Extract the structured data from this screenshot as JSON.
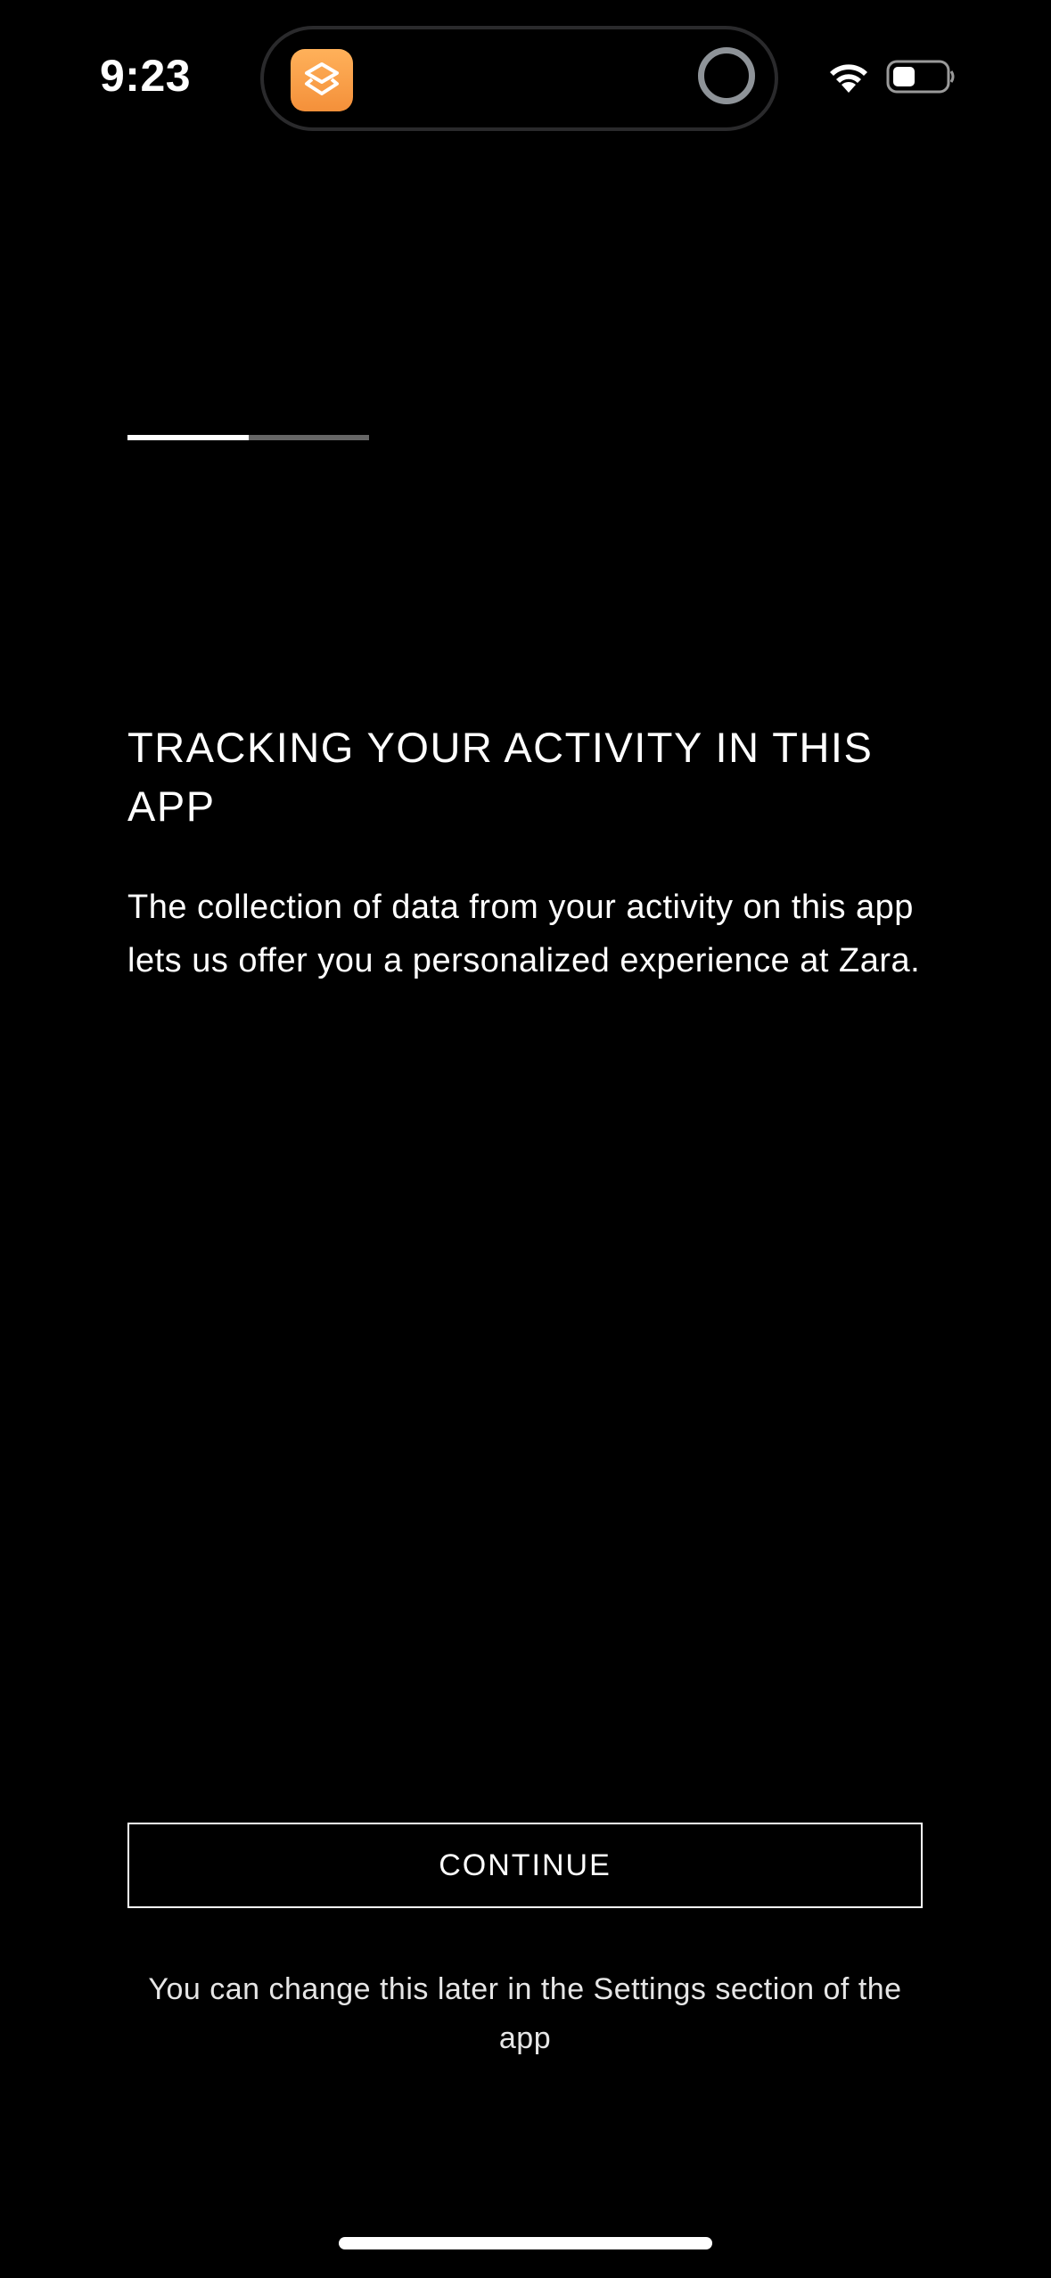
{
  "status_bar": {
    "time": "9:23",
    "live_activity_icon": "shortcuts-app-icon",
    "wifi_icon": "wifi-icon",
    "battery_icon": "battery-icon"
  },
  "onboarding": {
    "progress": {
      "fraction": 0.5
    },
    "title": "TRACKING YOUR ACTIVITY IN THIS APP",
    "description": "The collection of data from your activity on this app lets us offer you a personalized experience at Zara.",
    "continue_label": "CONTINUE",
    "footnote": "You can change this later in the Settings section of the app"
  },
  "colors": {
    "background": "#000000",
    "text": "#ffffff",
    "progress_track": "#666666",
    "app_icon_orange": "#f4903a"
  }
}
